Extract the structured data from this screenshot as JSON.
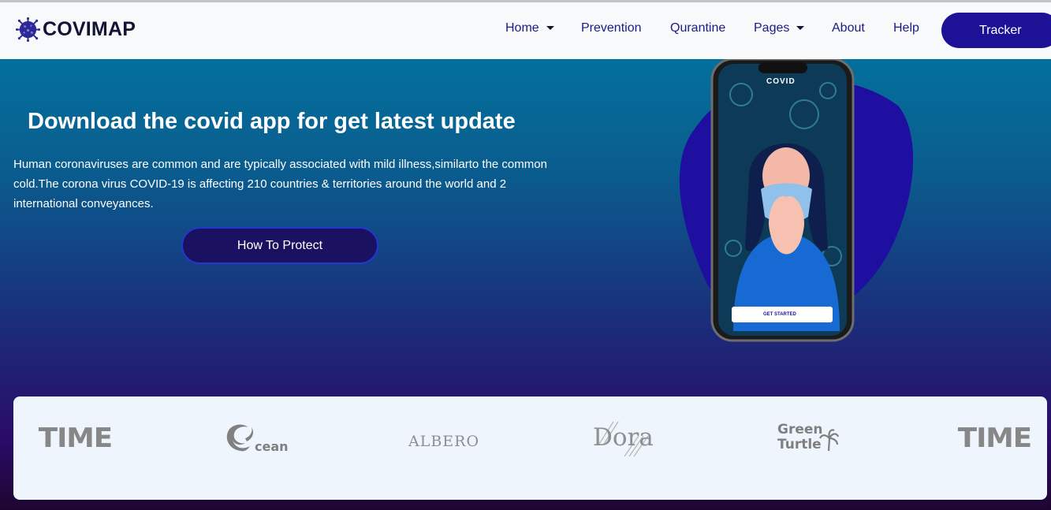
{
  "brand": {
    "name": "COVIMAP",
    "icon": "virus-icon"
  },
  "nav": {
    "home": "Home",
    "prevention": "Prevention",
    "quarantine": "Qurantine",
    "pages": "Pages",
    "about": "About",
    "help": "Help",
    "tracker": "Tracker"
  },
  "hero": {
    "title": "Download the covid app for get latest update",
    "text": "Human coronaviruses are common and are typically associated with mild illness,similarto the common cold.The corona virus COVID-19 is affecting 210 countries & territories around the world and 2 international conveyances.",
    "button": "How To Protect"
  },
  "phone": {
    "app_title": "COVID",
    "cta": "GET STARTED"
  },
  "partners": {
    "logos": [
      "TIME",
      "Ocean",
      "ALBERO",
      "Dora",
      "Green Turtle",
      "TIME"
    ],
    "time_text": "TIME",
    "ocean_text": "cean",
    "albero_text": "ALBERO",
    "dora_text": "Dora",
    "green_line1": "Green",
    "green_line2": "Turtle"
  },
  "colors": {
    "nav_text": "#1c1b86",
    "accent": "#1d1295",
    "blob": "#1f0fa0"
  }
}
